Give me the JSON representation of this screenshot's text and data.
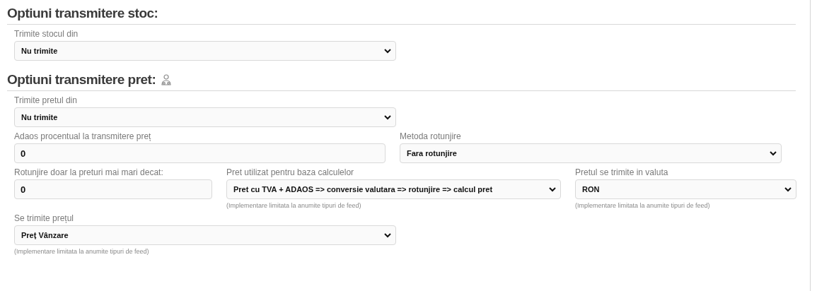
{
  "sections": [
    {
      "title": "Optiuni transmitere stoc:",
      "icon": false,
      "rows": [
        [
          {
            "kind": "select",
            "label": "Trimite stocul din",
            "value": "Nu trimite"
          }
        ]
      ]
    },
    {
      "title": "Optiuni transmitere pret:",
      "icon": true,
      "rows": [
        [
          {
            "kind": "select",
            "label": "Trimite pretul din",
            "value": "Nu trimite"
          }
        ],
        [
          {
            "kind": "input",
            "label": "Adaos procentual la transmitere preț",
            "value": "0"
          },
          {
            "kind": "select",
            "label": "Metoda rotunjire",
            "value": "Fara rotunjire"
          }
        ],
        [
          {
            "kind": "input",
            "label": "Rotunjire doar la preturi mai mari decat:",
            "value": "0"
          },
          {
            "kind": "select",
            "label": "Pret utilizat pentru baza calculelor",
            "value": "Pret cu TVA + ADAOS => conversie valutara => rotunjire => calcul pret",
            "note": "(Implementare limitata la anumite tipuri de feed)"
          },
          {
            "kind": "select",
            "label": "Pretul se trimite in valuta",
            "value": "RON",
            "note": "(Implementare limitata la anumite tipuri de feed)"
          }
        ],
        [
          {
            "kind": "select",
            "label": "Se trimite prețul",
            "value": "Preț Vânzare",
            "note": "(Implementare limitata la anumite tipuri de feed)"
          }
        ]
      ]
    }
  ]
}
